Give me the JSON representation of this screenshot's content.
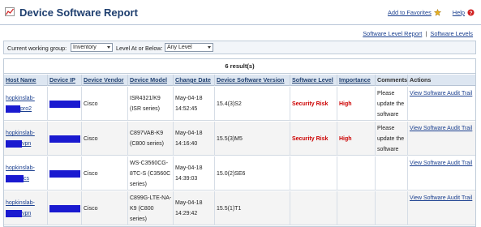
{
  "header": {
    "title": "Device Software Report",
    "add_favorites": "Add to Favorites",
    "help": "Help"
  },
  "sub_links": {
    "level_report": "Software Level Report",
    "separator": "|",
    "levels": "Software Levels"
  },
  "filters": {
    "group_label": "Current working group:",
    "group_value": "Inventory",
    "level_label": "Level At or Below:",
    "level_value": "Any Level"
  },
  "results": {
    "count_text": "6 result(s)"
  },
  "columns": [
    "Host Name",
    "Device IP",
    "Device Vendor",
    "Device Model",
    "Change Date",
    "Device Software Version",
    "Software Level",
    "Importance",
    "Comments",
    "Actions"
  ],
  "rows": [
    {
      "host_a": "hopkinslab-",
      "host_b": "pro2",
      "vendor": "Cisco",
      "model_lines": [
        "ISR4321/K9",
        "(ISR series)"
      ],
      "date_lines": [
        "May-04-18",
        "14:52:45"
      ],
      "version": "15.4(3)S2",
      "level": "Security Risk",
      "importance": "High",
      "comment_lines": [
        "Please",
        "update the",
        "software"
      ],
      "action": "View Software Audit Trail"
    },
    {
      "host_a": "hopkinslab-",
      "host_b": "vpn",
      "vendor": "Cisco",
      "model_lines": [
        "C897VAB-K9",
        "(C800 series)"
      ],
      "date_lines": [
        "May-04-18",
        "14:16:40"
      ],
      "version": "15.5(3)M5",
      "level": "Security Risk",
      "importance": "High",
      "comment_lines": [
        "Please",
        "update the",
        "software"
      ],
      "action": "View Software Audit Trail"
    },
    {
      "host_a": "hopkinslab-",
      "host_b": "cs",
      "vendor": "Cisco",
      "model_lines": [
        "WS-C3560CG-",
        "8TC-S (C3560C",
        "series)"
      ],
      "date_lines": [
        "May-04-18",
        "14:39:03"
      ],
      "version": "15.0(2)SE6",
      "level": "",
      "importance": "",
      "comment_lines": [],
      "action": "View Software Audit Trail"
    },
    {
      "host_a": "hopkinslab-",
      "host_b": "vpn",
      "vendor": "Cisco",
      "model_lines": [
        "C899G-LTE-NA-",
        "K9 (C800",
        "series)"
      ],
      "date_lines": [
        "May-04-18",
        "14:29:42"
      ],
      "version": "15.5(1)T1",
      "level": "",
      "importance": "",
      "comment_lines": [],
      "action": "View Software Audit Trail"
    }
  ],
  "colors": {
    "title": "#1f3f6f",
    "link": "#1a3f8f",
    "header_bg": "#dde6f1",
    "alt_row_bg": "#f4f4f4",
    "risk": "#cc0000",
    "redaction": "#1a1ad0"
  },
  "icons": {
    "title": "chart-report-icon",
    "favorites": "star-icon",
    "help": "question-icon"
  }
}
